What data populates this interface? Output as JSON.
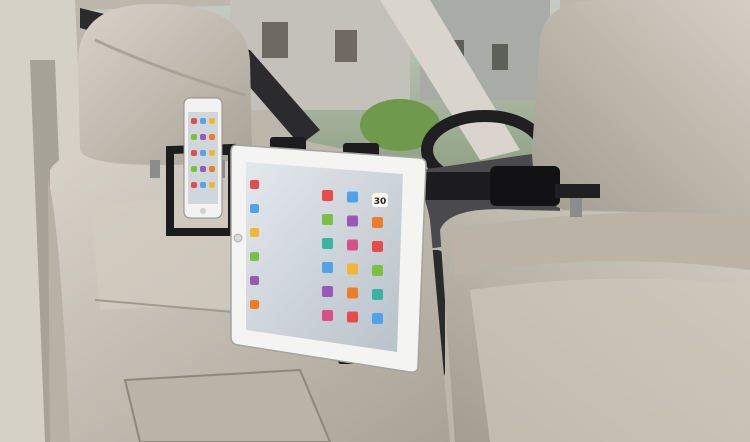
{
  "photo": {
    "subject": "tablet-and-phone-headrest-mount",
    "tablet": {
      "badge_number": "30",
      "icon_colors": [
        "#e94b4b",
        "#4fa3e8",
        "#f2b632",
        "#7bc043",
        "#9b59b6",
        "#f07c2a",
        "#3bb3a3",
        "#d94f8a"
      ]
    },
    "phone": {
      "icon_colors": [
        "#e94b4b",
        "#4fa3e8",
        "#f2b632",
        "#7bc043",
        "#9b59b6",
        "#f07c2a"
      ]
    },
    "colors": {
      "seat_leather": "#c9c3b7",
      "seat_shadow": "#9a9488",
      "mount_black": "#1c1c1e",
      "tablet_white": "#f4f4f2",
      "tablet_screen": "#cfd6dc",
      "window_glass": "#b9c2b4"
    }
  }
}
